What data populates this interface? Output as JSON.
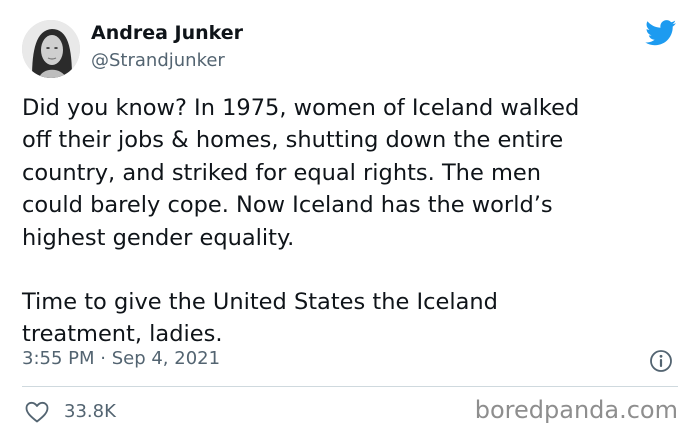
{
  "user": {
    "name": "Andrea Junker",
    "handle": "@Strandjunker",
    "avatar_icon": "profile-photo-avatar"
  },
  "tweet": {
    "paragraphs": [
      "Did you know? In 1975, women of Iceland walked\noff their jobs & homes, shutting down the entire\ncountry, and striked for equal rights. The men\ncould barely cope. Now Iceland has the world’s\nhighest gender equality.",
      "Time to give the United States the Iceland\ntreatment, ladies."
    ],
    "timestamp": "3:55 PM · Sep 4, 2021",
    "likes": "33.8K"
  },
  "icons": {
    "platform": "twitter-bird-icon",
    "info": "info-icon",
    "like": "heart-icon"
  },
  "watermark": "boredpanda.com",
  "colors": {
    "twitter_blue": "#1d9bf0",
    "text_primary": "#0f1419",
    "text_secondary": "#536471",
    "watermark": "#8e8e8e"
  }
}
